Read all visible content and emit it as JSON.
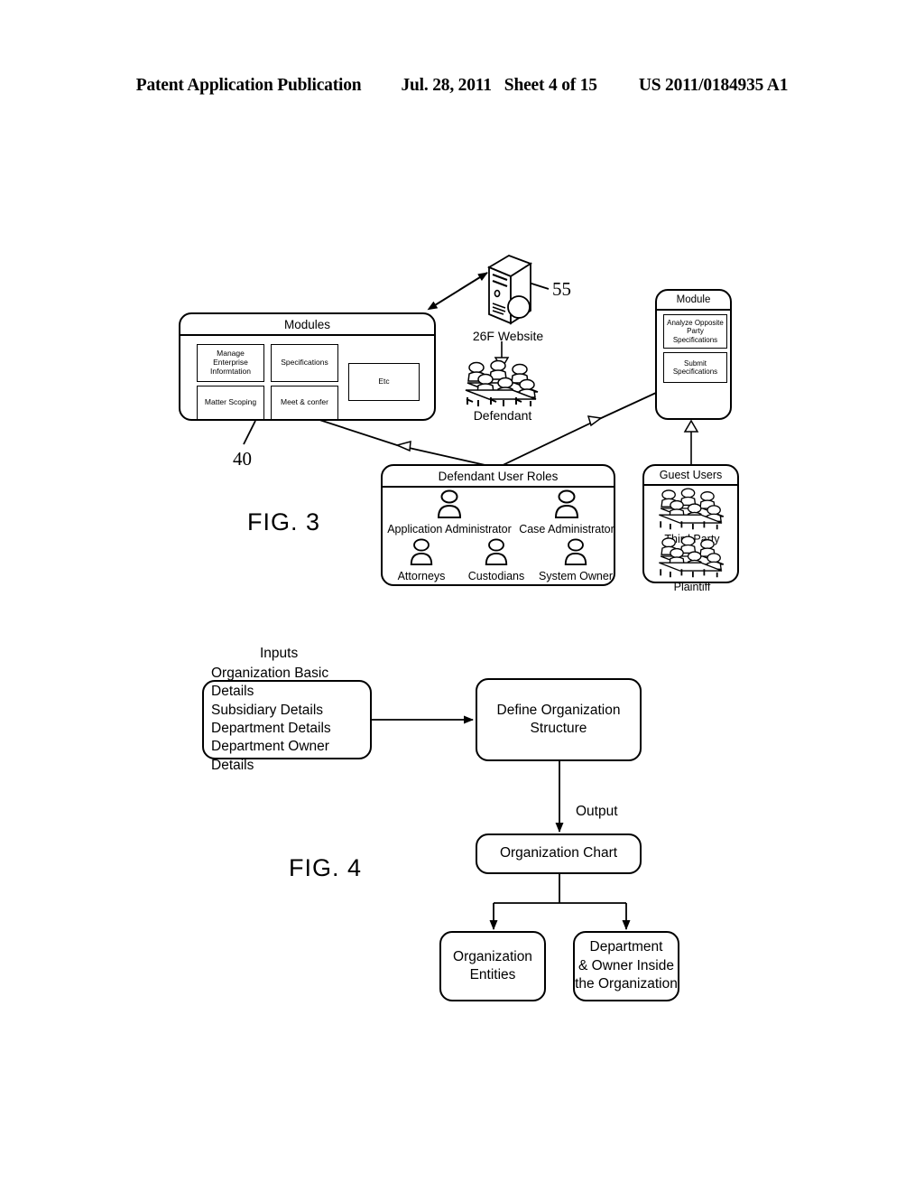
{
  "header": {
    "title": "Patent Application Publication",
    "date": "Jul. 28, 2011",
    "sheet": "Sheet 4 of 15",
    "number": "US 2011/0184935 A1"
  },
  "fig3": {
    "label": "FIG. 3",
    "ref_40": "40",
    "ref_55": "55",
    "modules_box": {
      "title": "Modules",
      "items": [
        {
          "label": "Manage Enterprise Informtation"
        },
        {
          "label": "Specifications"
        },
        {
          "label": "Matter Scoping"
        },
        {
          "label": "Meet & confer"
        },
        {
          "label": "Etc"
        }
      ]
    },
    "website": {
      "caption": "26F Website",
      "icon": "server-tower-icon"
    },
    "defendant": {
      "caption": "Defendant",
      "icon": "group-of-people-icon"
    },
    "module_box": {
      "title": "Module",
      "items": [
        {
          "label": "Analyze Opposite Party Specifications"
        },
        {
          "label": "Submit Specifications"
        }
      ]
    },
    "defendant_user_roles": {
      "title": "Defendant User Roles",
      "roles": [
        {
          "label": "Application Administrator",
          "icon": "person-icon"
        },
        {
          "label": "Case Administrator",
          "icon": "person-icon"
        },
        {
          "label": "Attorneys",
          "icon": "person-icon"
        },
        {
          "label": "Custodians",
          "icon": "person-icon"
        },
        {
          "label": "System Owner",
          "icon": "person-icon"
        }
      ]
    },
    "guest_users": {
      "title": "Guest Users",
      "groups": [
        {
          "label": "Third Party",
          "icon": "group-of-people-icon"
        },
        {
          "label": "Plaintiff",
          "icon": "group-of-people-icon"
        }
      ]
    }
  },
  "fig4": {
    "label": "FIG. 4",
    "inputs_label": "Inputs",
    "output_label": "Output",
    "inputs_box": {
      "lines": [
        "Organization Basic Details",
        "Subsidiary Details",
        "Department Details",
        "Department Owner Details"
      ]
    },
    "define_box": {
      "line1": "Define Organization",
      "line2": "Structure"
    },
    "chart_box": {
      "line1": "Organization Chart"
    },
    "entities_box": {
      "line1": "Organization",
      "line2": "Entities"
    },
    "department_box": {
      "line1": "Department",
      "line2": "& Owner Inside",
      "line3": "the Organization"
    }
  },
  "colors": {
    "ink": "#000000",
    "paper": "#ffffff"
  }
}
